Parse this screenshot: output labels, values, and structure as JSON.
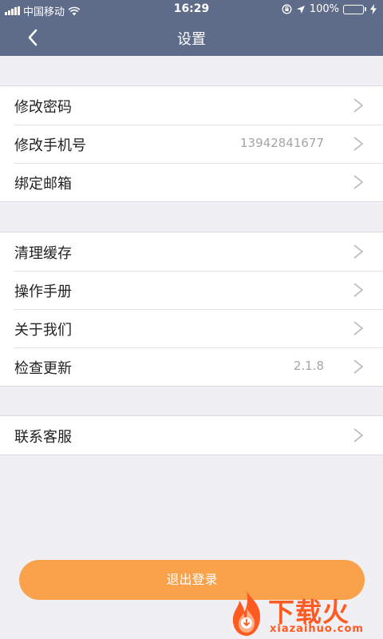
{
  "status_bar": {
    "carrier": "中国移动",
    "time": "16:29",
    "battery": "100%"
  },
  "nav": {
    "title": "设置"
  },
  "groups": [
    {
      "items": [
        {
          "label": "修改密码",
          "value": ""
        },
        {
          "label": "修改手机号",
          "value": "13942841677"
        },
        {
          "label": "绑定邮箱",
          "value": ""
        }
      ]
    },
    {
      "items": [
        {
          "label": "清理缓存",
          "value": ""
        },
        {
          "label": "操作手册",
          "value": ""
        },
        {
          "label": "关于我们",
          "value": ""
        },
        {
          "label": "检查更新",
          "value": "2.1.8"
        }
      ]
    },
    {
      "items": [
        {
          "label": "联系客服",
          "value": ""
        }
      ]
    }
  ],
  "logout_label": "退出登录",
  "watermark": {
    "brand": "下载火",
    "site": "xiazaihuo.com"
  },
  "colors": {
    "header": "#5e6b89",
    "background": "#efeff4",
    "logout": "#f9a14b",
    "watermark": "#ff5a1f"
  }
}
